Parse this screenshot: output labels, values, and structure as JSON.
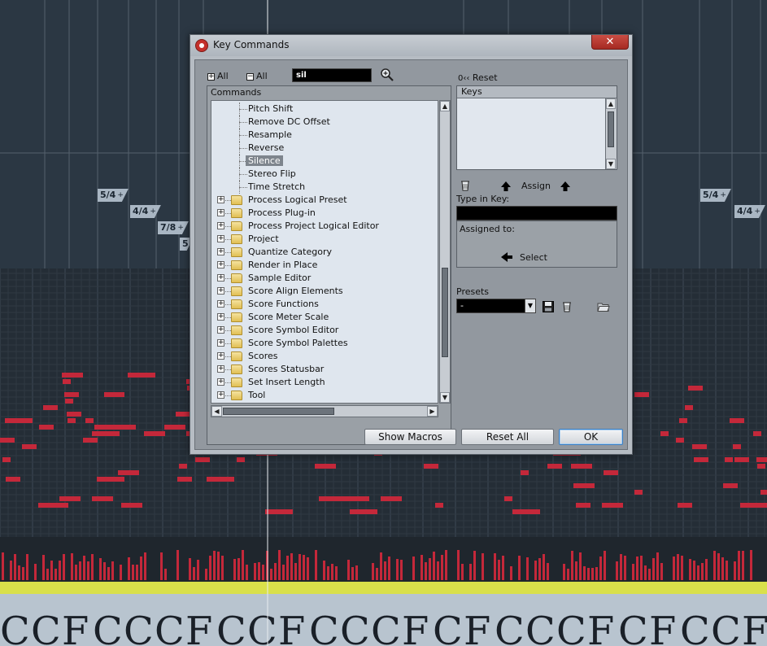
{
  "background": {
    "time_signatures": [
      {
        "label": "5/4"
      },
      {
        "label": "4/4"
      },
      {
        "label": "7/8"
      },
      {
        "label": "5"
      },
      {
        "label": "5/4"
      },
      {
        "label": "4/4"
      }
    ],
    "plus_sign": "+"
  },
  "dialog": {
    "title": "Key Commands",
    "close_label": "✕",
    "expand_all_label": "All",
    "collapse_all_label": "All",
    "search_value": "sil",
    "commands_header": "Commands",
    "tree_items": [
      {
        "label": "Pitch Shift",
        "type": "leaf",
        "selected": false
      },
      {
        "label": "Remove DC Offset",
        "type": "leaf",
        "selected": false
      },
      {
        "label": "Resample",
        "type": "leaf",
        "selected": false
      },
      {
        "label": "Reverse",
        "type": "leaf",
        "selected": false
      },
      {
        "label": "Silence",
        "type": "leaf",
        "selected": true
      },
      {
        "label": "Stereo Flip",
        "type": "leaf",
        "selected": false
      },
      {
        "label": "Time Stretch",
        "type": "leaf",
        "selected": false
      },
      {
        "label": "Process Logical Preset",
        "type": "folder",
        "selected": false
      },
      {
        "label": "Process Plug-in",
        "type": "folder",
        "selected": false
      },
      {
        "label": "Process Project Logical Editor",
        "type": "folder",
        "selected": false
      },
      {
        "label": "Project",
        "type": "folder",
        "selected": false
      },
      {
        "label": "Quantize Category",
        "type": "folder",
        "selected": false
      },
      {
        "label": "Render in Place",
        "type": "folder",
        "selected": false
      },
      {
        "label": "Sample Editor",
        "type": "folder",
        "selected": false
      },
      {
        "label": "Score Align Elements",
        "type": "folder",
        "selected": false
      },
      {
        "label": "Score Functions",
        "type": "folder",
        "selected": false
      },
      {
        "label": "Score Meter Scale",
        "type": "folder",
        "selected": false
      },
      {
        "label": "Score Symbol Editor",
        "type": "folder",
        "selected": false
      },
      {
        "label": "Score Symbol Palettes",
        "type": "folder",
        "selected": false
      },
      {
        "label": "Scores",
        "type": "folder",
        "selected": false
      },
      {
        "label": "Scores Statusbar",
        "type": "folder",
        "selected": false
      },
      {
        "label": "Set Insert Length",
        "type": "folder",
        "selected": false
      },
      {
        "label": "Tool",
        "type": "folder",
        "selected": false
      }
    ],
    "reset_label": "Reset",
    "reset_prefix": "0‹‹",
    "keys_header": "Keys",
    "assign_label": "Assign",
    "type_in_key_label": "Type in Key:",
    "assigned_to_label": "Assigned to:",
    "select_label": "Select",
    "presets_label": "Presets",
    "presets_value": "-",
    "show_macros_label": "Show Macros",
    "reset_all_label": "Reset All",
    "ok_label": "OK"
  },
  "colors": {
    "note_red": "#c4283a",
    "timeline_yellow": "#d9e04a",
    "accent_blue": "#3b7fc4"
  }
}
